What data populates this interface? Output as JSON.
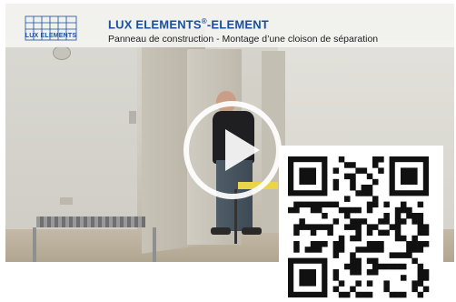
{
  "logo": {
    "text": "LUX ELEMENTS"
  },
  "header": {
    "brand": "LUX ELEMENTS",
    "brand_sup": "®",
    "brand_suffix": "-ELEMENT",
    "subtitle": "Panneau de construction - Montage d’une cloison de séparation"
  },
  "colors": {
    "brand_blue": "#1a4f9e",
    "title_bg": "#f5f5f3",
    "qr": "#111111"
  },
  "icons": {
    "play": "play-icon",
    "qr": "qr-code"
  }
}
